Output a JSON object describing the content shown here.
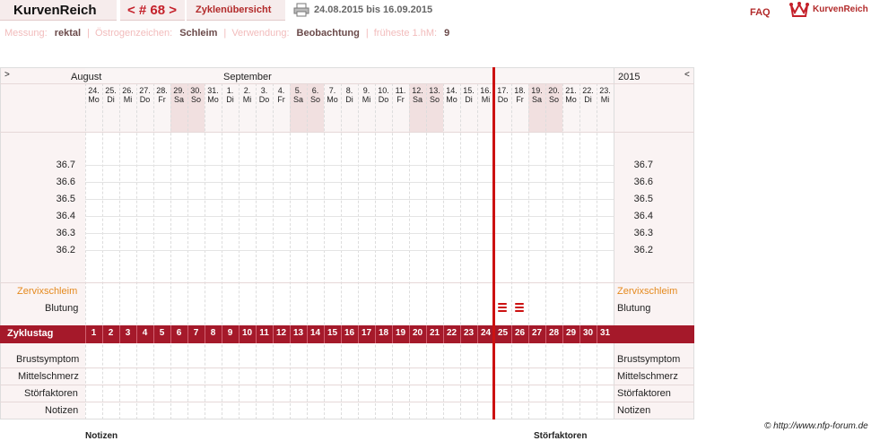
{
  "header": {
    "brand": "KurvenReich",
    "cycle": "< # 68 >",
    "overview": "Zyklenübersicht",
    "daterange": "24.08.2015 bis 16.09.2015",
    "faq": "FAQ",
    "logo_text": "KurvenReich"
  },
  "info": {
    "messung_label": "Messung:",
    "messung_value": "rektal",
    "oestrogen_label": "Östrogenzeichen:",
    "oestrogen_value": "Schleim",
    "verwendung_label": "Verwendung:",
    "verwendung_value": "Beobachtung",
    "fhm_label": "früheste 1.hM:",
    "fhm_value": "9"
  },
  "chart": {
    "nav_left": ">",
    "nav_right": "<",
    "year": "2015",
    "months": [
      "August",
      "September"
    ],
    "days": [
      {
        "d": "24.",
        "w": "Mo"
      },
      {
        "d": "25.",
        "w": "Di"
      },
      {
        "d": "26.",
        "w": "Mi"
      },
      {
        "d": "27.",
        "w": "Do"
      },
      {
        "d": "28.",
        "w": "Fr"
      },
      {
        "d": "29.",
        "w": "Sa",
        "we": true
      },
      {
        "d": "30.",
        "w": "So",
        "we": true
      },
      {
        "d": "31.",
        "w": "Mo"
      },
      {
        "d": "1.",
        "w": "Di"
      },
      {
        "d": "2.",
        "w": "Mi"
      },
      {
        "d": "3.",
        "w": "Do"
      },
      {
        "d": "4.",
        "w": "Fr"
      },
      {
        "d": "5.",
        "w": "Sa",
        "we": true
      },
      {
        "d": "6.",
        "w": "So",
        "we": true
      },
      {
        "d": "7.",
        "w": "Mo"
      },
      {
        "d": "8.",
        "w": "Di"
      },
      {
        "d": "9.",
        "w": "Mi"
      },
      {
        "d": "10.",
        "w": "Do"
      },
      {
        "d": "11.",
        "w": "Fr"
      },
      {
        "d": "12.",
        "w": "Sa",
        "we": true
      },
      {
        "d": "13.",
        "w": "So",
        "we": true
      },
      {
        "d": "14.",
        "w": "Mo"
      },
      {
        "d": "15.",
        "w": "Di"
      },
      {
        "d": "16.",
        "w": "Mi"
      },
      {
        "d": "17.",
        "w": "Do"
      },
      {
        "d": "18.",
        "w": "Fr"
      },
      {
        "d": "19.",
        "w": "Sa",
        "we": true
      },
      {
        "d": "20.",
        "w": "So",
        "we": true
      },
      {
        "d": "21.",
        "w": "Mo"
      },
      {
        "d": "22.",
        "w": "Di"
      },
      {
        "d": "23.",
        "w": "Mi"
      }
    ],
    "temps": [
      "36.7",
      "36.6",
      "36.5",
      "36.4",
      "36.3",
      "36.2"
    ],
    "rows": {
      "zervix": "Zervixschleim",
      "blutung": "Blutung",
      "zyklustag": "Zyklustag",
      "brust": "Brustsymptom",
      "mittel": "Mittelschmerz",
      "stoer": "Störfaktoren",
      "notizen": "Notizen"
    },
    "cycle_days": [
      "1",
      "2",
      "3",
      "4",
      "5",
      "6",
      "7",
      "8",
      "9",
      "10",
      "11",
      "12",
      "13",
      "14",
      "15",
      "16",
      "17",
      "18",
      "19",
      "20",
      "21",
      "22",
      "23",
      "24",
      "25",
      "26",
      "27",
      "28",
      "29",
      "30",
      "31"
    ],
    "bleeding_days": [
      "25",
      "26"
    ]
  },
  "footer": {
    "copyright": "© http://www.nfp-forum.de",
    "notizen": "Notizen",
    "stoerfaktoren": "Störfaktoren"
  }
}
